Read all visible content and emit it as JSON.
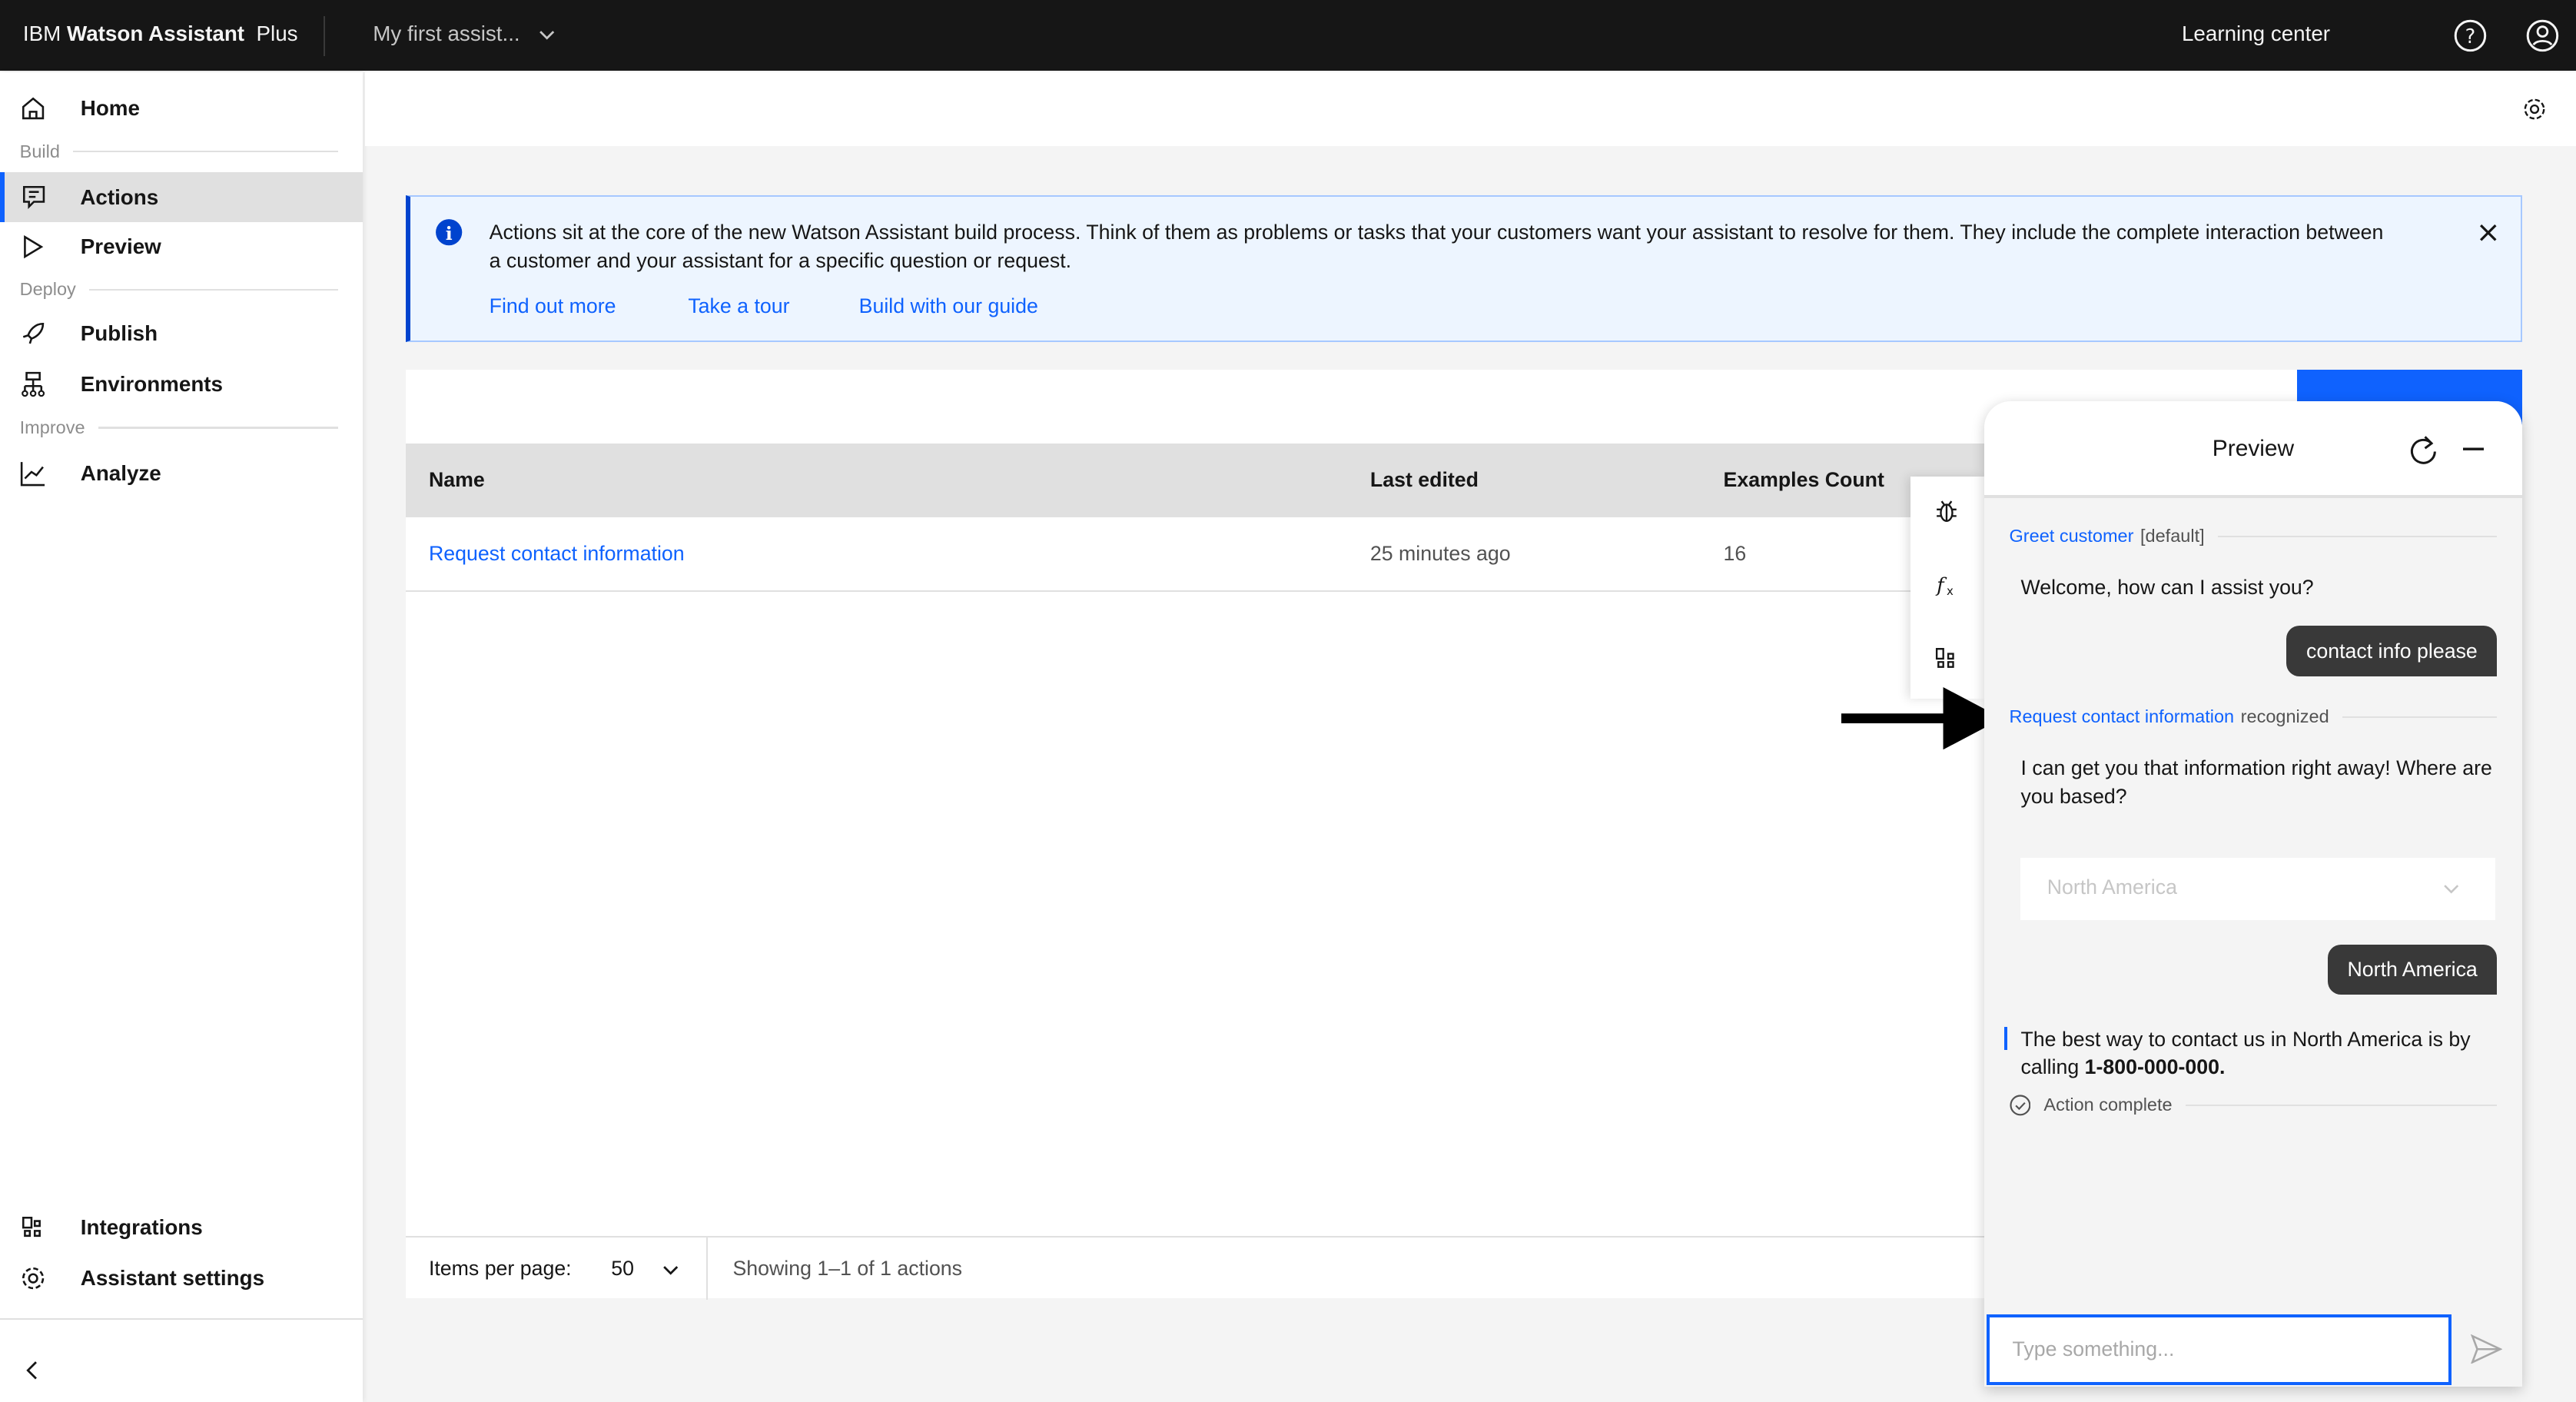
{
  "header": {
    "brand_prefix": "IBM",
    "brand_name": "Watson Assistant",
    "plan": "Plus",
    "assistant": "My first assist...",
    "learning_center": "Learning center",
    "icons": [
      "help-icon",
      "user-avatar-icon"
    ]
  },
  "sidebar": {
    "home": "Home",
    "build": "Build",
    "actions": "Actions",
    "preview": "Preview",
    "deploy": "Deploy",
    "publish": "Publish",
    "environments": "Environments",
    "improve": "Improve",
    "analyze": "Analyze",
    "integrations": "Integrations",
    "settings": "Assistant settings",
    "active": "Actions"
  },
  "banner": {
    "text": "Actions sit at the core of the new Watson Assistant build process. Think of them as problems or tasks that your customers want your assistant to resolve for them. They include the complete interaction between a customer and your assistant for a specific question or request.",
    "links": [
      "Find out more",
      "Take a tour",
      "Build with our guide"
    ]
  },
  "table": {
    "columns": [
      "Name",
      "Last edited",
      "Examples Count"
    ],
    "rows": [
      {
        "name": "Request contact information",
        "last_edited": "25 minutes ago",
        "examples": "16"
      }
    ]
  },
  "pagination": {
    "items_per_page_label": "Items per page:",
    "items_per_page": "50",
    "showing": "Showing 1–1 of 1 actions"
  },
  "preview": {
    "title": "Preview",
    "greet_action": "Greet customer",
    "greet_tag": "[default]",
    "bot1": "Welcome, how can I assist you?",
    "user1": "contact info please",
    "recognized_action": "Request contact information",
    "recognized_label": "recognized",
    "bot2": "I can get you that information right away! Where are you based?",
    "dropdown_value": "North America",
    "user2": "North America",
    "bot3_prefix": "The best way to contact us in North America is by calling ",
    "bot3_phone": "1-800-000-000.",
    "complete": "Action complete",
    "input_placeholder": "Type something..."
  },
  "colors": {
    "accent": "#0f62fe",
    "topbar": "#161616"
  }
}
